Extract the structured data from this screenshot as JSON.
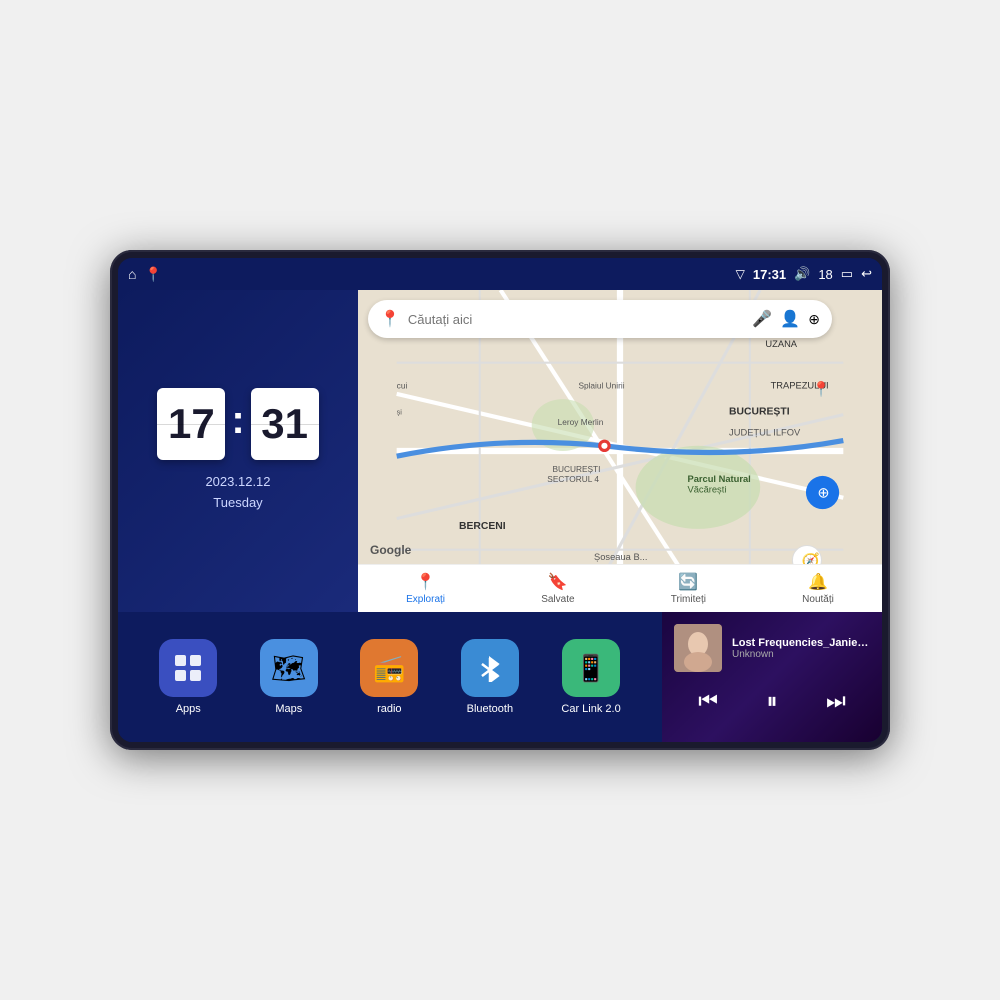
{
  "device": {
    "status_bar": {
      "left_icons": [
        "home-icon",
        "maps-icon"
      ],
      "time": "17:31",
      "volume_icon": "🔊",
      "volume_level": "18",
      "battery_icon": "🔋",
      "back_icon": "↩"
    },
    "clock": {
      "hours": "17",
      "minutes": "31",
      "date": "2023.12.12",
      "day": "Tuesday"
    },
    "map": {
      "search_placeholder": "Căutați aici",
      "nav_items": [
        {
          "label": "Explorați",
          "icon": "📍",
          "active": true
        },
        {
          "label": "Salvate",
          "icon": "🔖",
          "active": false
        },
        {
          "label": "Trimiteți",
          "icon": "🔄",
          "active": false
        },
        {
          "label": "Noutăți",
          "icon": "🔔",
          "active": false
        }
      ]
    },
    "apps": [
      {
        "id": "apps",
        "label": "Apps",
        "icon": "⊞",
        "color_class": "icon-apps"
      },
      {
        "id": "maps",
        "label": "Maps",
        "icon": "🗺",
        "color_class": "icon-maps"
      },
      {
        "id": "radio",
        "label": "radio",
        "icon": "📻",
        "color_class": "icon-radio"
      },
      {
        "id": "bluetooth",
        "label": "Bluetooth",
        "icon": "⬡",
        "color_class": "icon-bluetooth"
      },
      {
        "id": "carlink",
        "label": "Car Link 2.0",
        "icon": "🚗",
        "color_class": "icon-carlink"
      }
    ],
    "music": {
      "title": "Lost Frequencies_Janieck Devy-...",
      "artist": "Unknown",
      "controls": {
        "prev": "⏮",
        "play_pause": "⏸",
        "next": "⏭"
      }
    }
  }
}
